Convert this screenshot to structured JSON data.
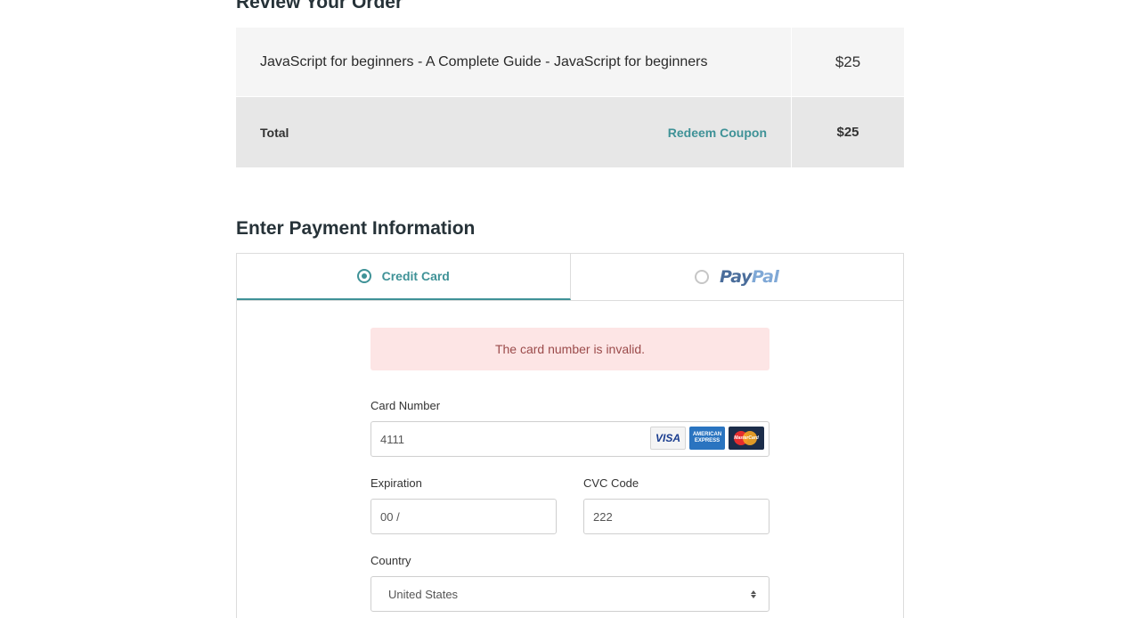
{
  "review": {
    "title": "Review Your Order",
    "item": {
      "name": "JavaScript for beginners - A Complete Guide - JavaScript for beginners",
      "price": "$25"
    },
    "total": {
      "label": "Total",
      "coupon_label": "Redeem Coupon",
      "price": "$25"
    }
  },
  "payment": {
    "title": "Enter Payment Information",
    "tabs": [
      {
        "label": "Credit Card",
        "selected": true
      },
      {
        "label": "PayPal",
        "logo_parts": [
          "Pay",
          "Pal"
        ],
        "selected": false
      }
    ],
    "error_message": "The card number is invalid.",
    "card_number": {
      "label": "Card Number",
      "value": "4111",
      "card_brands": {
        "visa": "VISA",
        "amex_line1": "AMERICAN",
        "amex_line2": "EXPRESS",
        "mastercard": "MasterCard"
      }
    },
    "expiration": {
      "label": "Expiration",
      "value": "00 /"
    },
    "cvc": {
      "label": "CVC Code",
      "value": "222"
    },
    "country": {
      "label": "Country",
      "value": "United States"
    }
  },
  "colors": {
    "accent": "#3f9297",
    "error_bg": "#fde5e5",
    "error_text": "#9b4b4b"
  }
}
